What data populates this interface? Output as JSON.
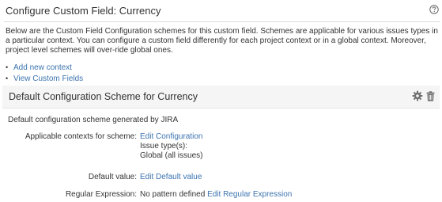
{
  "page": {
    "title": "Configure Custom Field: Currency",
    "description": "Below are the Custom Field Configuration schemes for this custom field. Schemes are applicable for various issues types in a particular context. You can configure a custom field differently for each project context or in a global context. Moreover, project level schemes will over-ride global ones.",
    "links": [
      "Add new context",
      "View Custom Fields"
    ]
  },
  "scheme": {
    "title": "Default Configuration Scheme for Currency",
    "description": "Default configuration scheme generated by JIRA",
    "contexts": {
      "label": "Applicable contexts for scheme:",
      "edit_link": "Edit Configuration",
      "issue_types_label": "Issue type(s):",
      "issue_types_value": "Global (all issues)"
    },
    "default_value": {
      "label": "Default value:",
      "edit_link": "Edit Default value"
    },
    "regex": {
      "label": "Regular Expression:",
      "value": "No pattern defined",
      "edit_link": "Edit Regular Expression"
    }
  },
  "icons": {
    "help": "question-circle-icon",
    "settings": "gear-icon",
    "delete": "trash-icon"
  },
  "colors": {
    "link": "#3b73af",
    "text": "#333333",
    "header_bg": "#f5f5f5"
  }
}
